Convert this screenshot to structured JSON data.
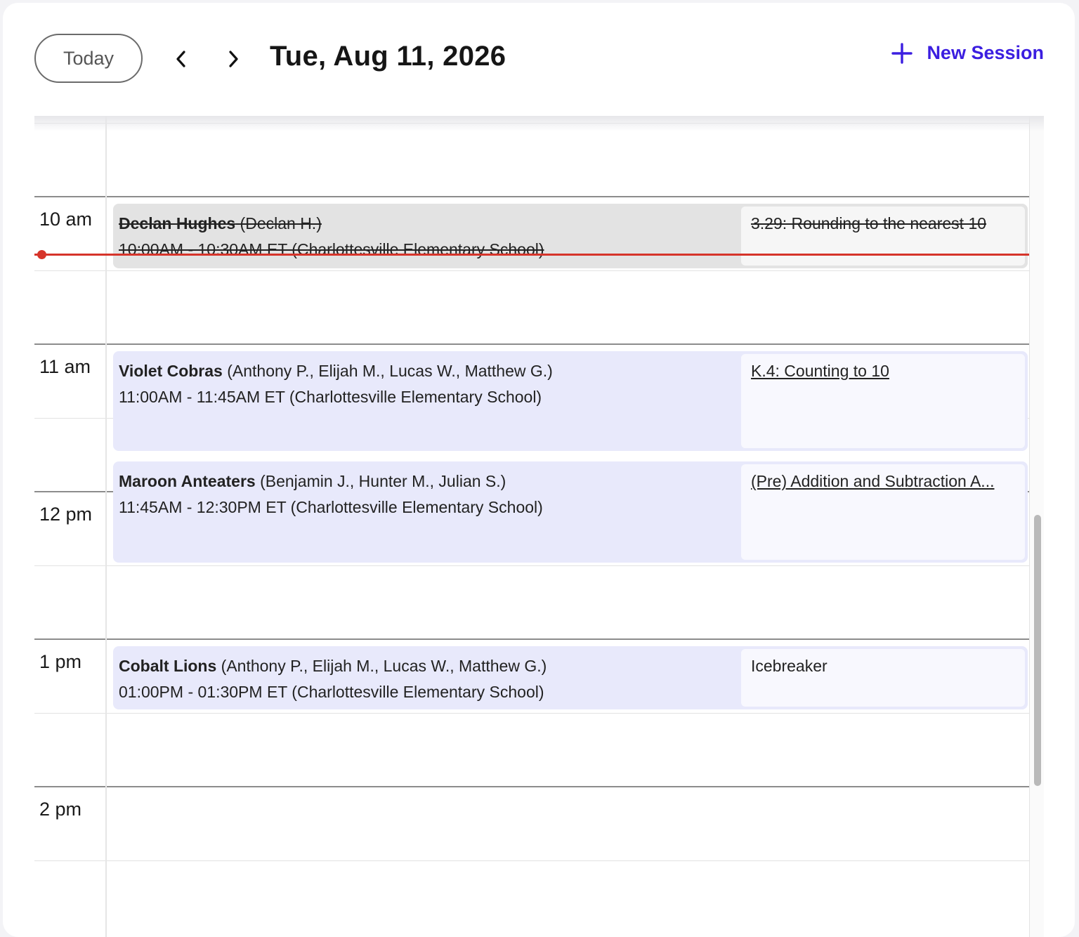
{
  "header": {
    "today_label": "Today",
    "date_title": "Tue, Aug 11, 2026",
    "new_session_label": "New Session"
  },
  "calendar": {
    "hour_labels": [
      "10 am",
      "11 am",
      "12 pm",
      "1 pm",
      "2 pm"
    ],
    "now_indicator_color": "#d6342a",
    "events": [
      {
        "name": "Declan Hughes",
        "members": "(Declan H.)",
        "time": "10:00AM - 10:30AM ET (Charlottesville Elementary School)",
        "lesson": "3.29: Rounding to the nearest 10",
        "cancelled": true
      },
      {
        "name": "Violet Cobras",
        "members": "(Anthony P., Elijah M., Lucas W., Matthew G.)",
        "time": "11:00AM - 11:45AM ET (Charlottesville Elementary School)",
        "lesson": "K.4: Counting to 10",
        "cancelled": false
      },
      {
        "name": "Maroon Anteaters",
        "members": "(Benjamin J., Hunter M., Julian S.)",
        "time": "11:45AM - 12:30PM ET (Charlottesville Elementary School)",
        "lesson": "(Pre) Addition and Subtraction A...",
        "cancelled": false
      },
      {
        "name": "Cobalt Lions",
        "members": "(Anthony P., Elijah M., Lucas W., Matthew G.)",
        "time": "01:00PM - 01:30PM ET (Charlottesville Elementary School)",
        "lesson": "Icebreaker",
        "cancelled": false
      }
    ]
  },
  "colors": {
    "accent": "#3b1ee0",
    "event_bg": "#e8e9fb",
    "cancelled_bg": "#e3e3e3"
  }
}
